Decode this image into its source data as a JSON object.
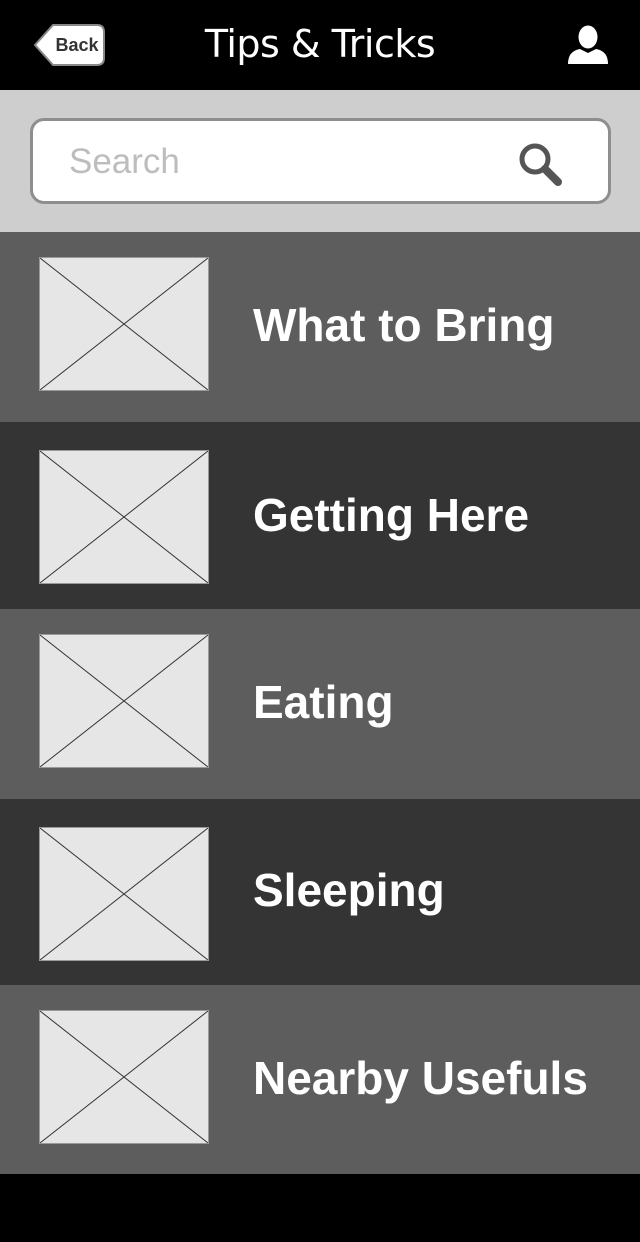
{
  "header": {
    "back_label": "Back",
    "title": "Tips & Tricks",
    "user_icon": "user-icon"
  },
  "search": {
    "placeholder": "Search",
    "value": "",
    "icon": "search-icon"
  },
  "items": [
    {
      "label": "What to Bring",
      "tone": "light"
    },
    {
      "label": "Getting Here",
      "tone": "dark"
    },
    {
      "label": "Eating",
      "tone": "light"
    },
    {
      "label": "Sleeping",
      "tone": "dark"
    },
    {
      "label": "Nearby Usefuls",
      "tone": "light"
    }
  ],
  "colors": {
    "header_bg": "#000000",
    "search_band_bg": "#cecece",
    "row_light": "#5d5d5d",
    "row_dark": "#343434",
    "placeholder_image_bg": "#e6e6e6"
  }
}
